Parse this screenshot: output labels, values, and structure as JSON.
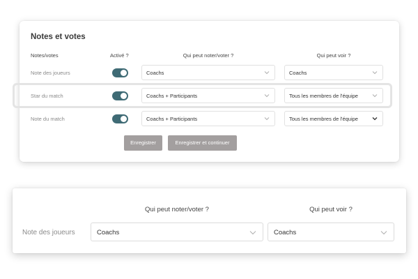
{
  "card": {
    "title": "Notes et votes",
    "headers": {
      "label": "Notes/votes",
      "active": "Activé ?",
      "who_vote": "Qui peut noter/voter ?",
      "who_see": "Qui peut voir ?"
    },
    "rows": [
      {
        "label": "Note des joueurs",
        "active": true,
        "who_vote": "Coachs",
        "who_see": "Coachs"
      },
      {
        "label": "Star du match",
        "active": true,
        "who_vote": "Coachs + Participants",
        "who_see": "Tous les membres de l'équipe"
      },
      {
        "label": "Note du match",
        "active": true,
        "who_vote": "Coachs + Participants",
        "who_see": "Tous les membres de l'équipe"
      }
    ],
    "buttons": {
      "save": "Enregistrer",
      "save_continue": "Enregistrer et continuer"
    }
  },
  "zoom": {
    "headers": {
      "who_vote": "Qui peut noter/voter ?",
      "who_see": "Qui peut voir ?"
    },
    "row": {
      "label": "Note des joueurs",
      "who_vote": "Coachs",
      "who_see": "Coachs"
    }
  },
  "icons": {
    "dropdown": "chevron-down-icon"
  },
  "colors": {
    "toggle_on": "#3f6b75",
    "button_bg": "#a39f9f"
  }
}
